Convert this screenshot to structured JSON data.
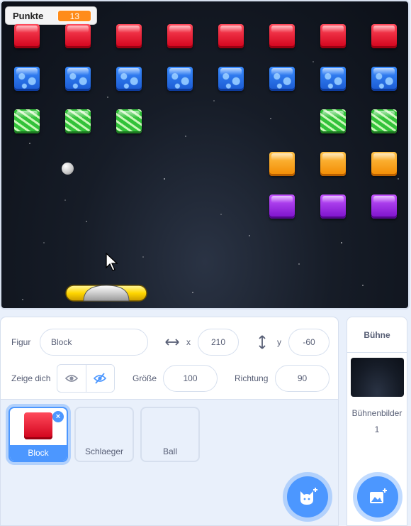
{
  "monitor": {
    "label": "Punkte",
    "value": "13"
  },
  "sprite_info": {
    "figur_label": "Figur",
    "name_value": "Block",
    "x_label": "x",
    "x_value": "210",
    "y_label": "y",
    "y_value": "-60",
    "show_label": "Zeige dich",
    "size_label": "Größe",
    "size_value": "100",
    "direction_label": "Richtung",
    "direction_value": "90"
  },
  "sprites": [
    {
      "name": "Block",
      "selected": true
    },
    {
      "name": "Schlaeger",
      "selected": false
    },
    {
      "name": "Ball",
      "selected": false
    }
  ],
  "stage_panel": {
    "title": "Bühne",
    "backdrops_label": "Bühnenbilder",
    "backdrops_count": "1"
  },
  "icons": [
    "show-icon",
    "hide-icon",
    "choose-sprite-icon",
    "choose-backdrop-icon",
    "mouse-cursor-icon",
    "delete-icon",
    "arrows-horizontal-icon",
    "arrows-vertical-icon"
  ],
  "colors": {
    "accent": "#4c97ff",
    "monitor_value": "#ff8c1a"
  }
}
